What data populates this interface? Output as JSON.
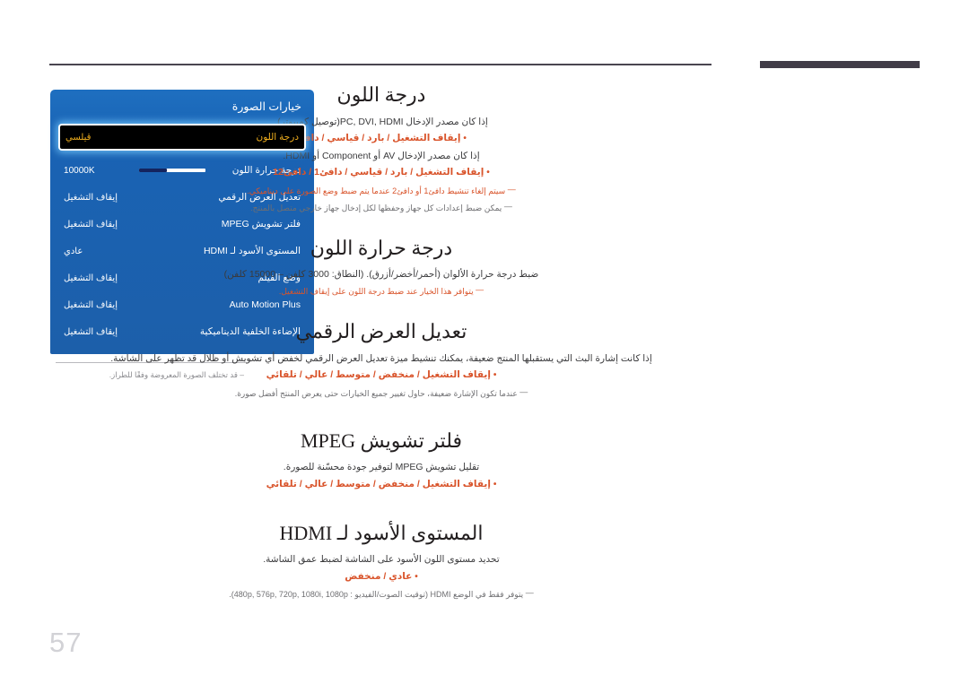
{
  "page": {
    "number": "57"
  },
  "figure": {
    "caption_dash": "–",
    "caption": "قد تختلف الصورة المعروضة وفقًا للطراز."
  },
  "osd": {
    "title": "خيارات الصورة",
    "rows": [
      {
        "label": "درجة اللون",
        "value": "قيلسي",
        "selected": true,
        "type": "value"
      },
      {
        "label": "درجة حرارة اللون",
        "value": "10000K",
        "selected": false,
        "type": "slider",
        "slider_percent": 42
      },
      {
        "label": "تعديل العرض الرقمي",
        "value": "إيقاف التشغيل",
        "selected": false,
        "type": "value"
      },
      {
        "label": "فلتر تشويش MPEG",
        "value": "إيقاف التشغيل",
        "selected": false,
        "type": "value"
      },
      {
        "label": "المستوى الأسود لـ HDMI",
        "value": "عادي",
        "selected": false,
        "type": "value"
      },
      {
        "label": "وضع الفيلم",
        "value": "إيقاف التشغيل",
        "selected": false,
        "type": "value"
      },
      {
        "label": "Auto Motion Plus",
        "value": "إيقاف التشغيل",
        "selected": false,
        "type": "value"
      },
      {
        "label": "الإضاءة الخلفية الديناميكية",
        "value": "إيقاف التشغيل",
        "selected": false,
        "type": "value"
      }
    ]
  },
  "sections": {
    "color_tone": {
      "title": "درجة اللون",
      "desc1": "إذا كان مصدر الإدخال PC, DVI, HDMI(توصيل كمبيوتر).",
      "opts1": "إيقاف التشغيل / بارد / قياسي / دافئ",
      "desc2": "إذا كان مصدر الإدخال AV أو Component أو HDMI.",
      "opts2": "إيقاف التشغيل / بارد / قياسي / دافئ1 / دافئ12",
      "note1": "سيتم إلغاء تنشيط دافئ1 أو دافئ2 عندما يتم ضبط وضع الصورة على ديناميكي.",
      "note2": "يمكن ضبط إعدادات كل جهاز وحفظها لكل إدخال جهاز خارجي متصل بالمنتج."
    },
    "color_temp": {
      "title": "درجة حرارة اللون",
      "desc1": "ضبط درجة حرارة الألوان (أحمر/أخضر/أزرق). (النطاق: 3000 كلفن – 15000 كلفن)",
      "note1": "يتوافر هذا الخيار عند ضبط درجة اللون على إيقاف التشغيل."
    },
    "digital_clean": {
      "title": "تعديل العرض الرقمي",
      "desc1": "إذا كانت إشارة البث التي يستقبلها المنتج ضعيفة، يمكنك تنشيط ميزة تعديل العرض الرقمي لخفض أي تشويش أو ظلال قد تظهر على الشاشة.",
      "opts1": "إيقاف التشغيل / منخفض / متوسط / عالي / تلقائي",
      "note1": "عندما تكون الإشارة ضعيفة، حاول تغيير جميع الخيارات حتى يعرض المنتج أفضل صورة."
    },
    "mpeg_filter": {
      "title": "فلتر تشويش MPEG",
      "desc1": "تقليل تشويش MPEG لتوفير جودة محسّنة للصورة.",
      "opts1": "إيقاف التشغيل / منخفض / متوسط / عالي / تلقائي"
    },
    "hdmi_black": {
      "title": "المستوى الأسود لـ HDMI",
      "desc1": "تحديد مستوى اللون الأسود على الشاشة لضبط عمق الشاشة.",
      "opts1": "عادي / منخفض",
      "note1": "يتوفر فقط في الوضع HDMI (توقيت الصوت/الفيديو : 480p, 576p, 720p, 1080i, 1080p)."
    }
  }
}
